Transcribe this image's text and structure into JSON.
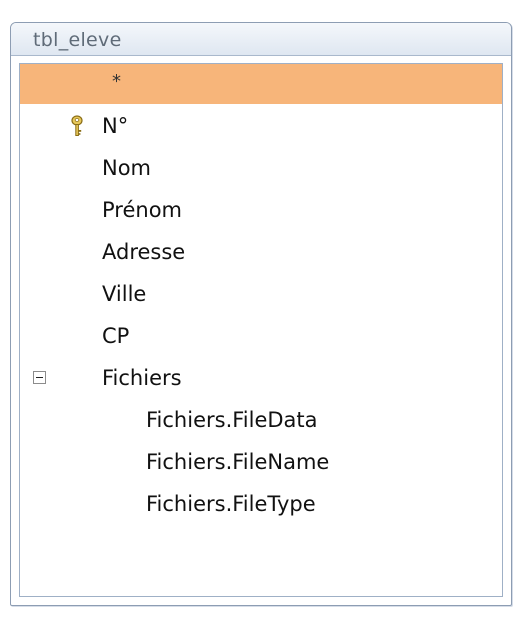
{
  "window": {
    "title": "tbl_eleve"
  },
  "fields": {
    "all": "*",
    "id": "N°",
    "nom": "Nom",
    "prenom": "Prénom",
    "adresse": "Adresse",
    "ville": "Ville",
    "cp": "CP",
    "fichiers": "Fichiers",
    "filedata": "Fichiers.FileData",
    "filename": "Fichiers.FileName",
    "filetype": "Fichiers.FileType"
  },
  "icons": {
    "primary_key": "key-icon",
    "collapse": "minus-box-icon"
  },
  "colors": {
    "selection": "#f7b57a",
    "title_text": "#5f6b78",
    "border": "#8d9db3"
  }
}
